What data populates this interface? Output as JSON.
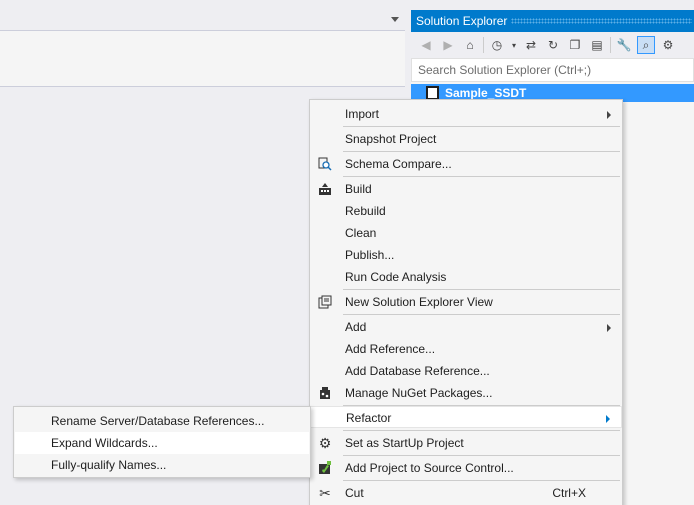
{
  "solution_explorer": {
    "title": "Solution Explorer",
    "search_placeholder": "Search Solution Explorer (Ctrl+;)",
    "project_name": "Sample_SSDT"
  },
  "context_menu": {
    "items": [
      {
        "label": "Import",
        "has_submenu": true
      },
      {
        "label": "Snapshot Project"
      },
      {
        "label": "Schema Compare...",
        "icon": "schema-compare-icon"
      },
      {
        "label": "Build",
        "icon": "build-icon"
      },
      {
        "label": "Rebuild"
      },
      {
        "label": "Clean"
      },
      {
        "label": "Publish..."
      },
      {
        "label": "Run Code Analysis"
      },
      {
        "label": "New Solution Explorer View",
        "icon": "new-view-icon"
      },
      {
        "label": "Add",
        "has_submenu": true
      },
      {
        "label": "Add Reference..."
      },
      {
        "label": "Add Database Reference..."
      },
      {
        "label": "Manage NuGet Packages...",
        "icon": "nuget-icon"
      },
      {
        "label": "Refactor",
        "has_submenu": true,
        "highlighted": true
      },
      {
        "label": "Set as StartUp Project",
        "icon": "gear-icon"
      },
      {
        "label": "Add Project to Source Control...",
        "icon": "source-control-icon"
      },
      {
        "label": "Cut",
        "icon": "scissors-icon",
        "shortcut": "Ctrl+X"
      }
    ]
  },
  "refactor_submenu": {
    "items": [
      {
        "label": "Rename Server/Database References..."
      },
      {
        "label": "Expand Wildcards...",
        "highlighted": true
      },
      {
        "label": "Fully-qualify Names..."
      }
    ]
  },
  "colors": {
    "accent": "#007acc",
    "selection": "#3399ff",
    "menu_bg": "#f5f5f5"
  }
}
